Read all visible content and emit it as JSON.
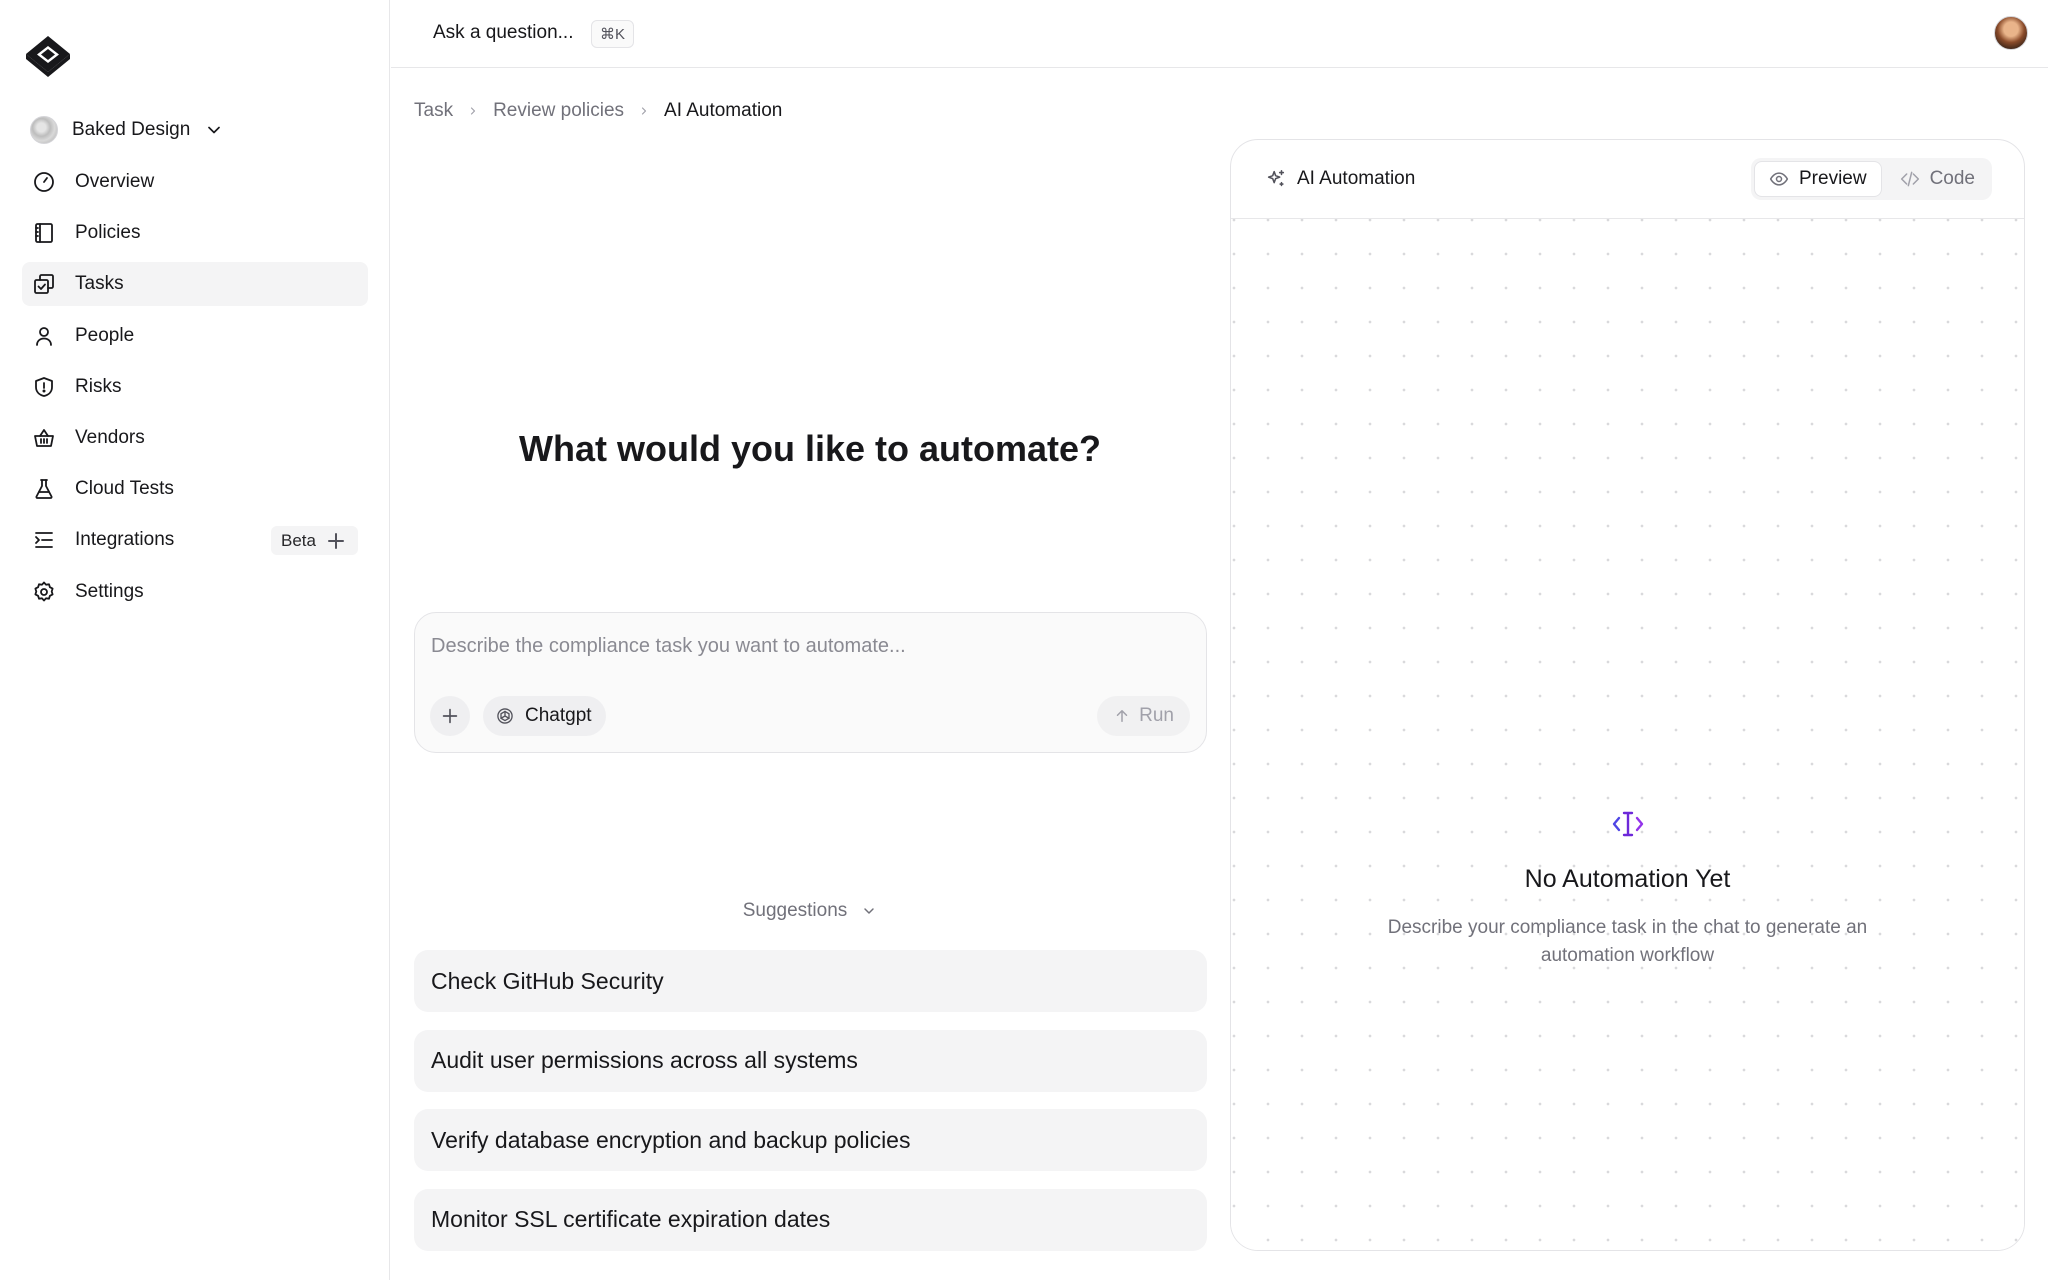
{
  "sidebar": {
    "org_name": "Baked Design",
    "items": [
      {
        "label": "Overview",
        "icon": "gauge-icon"
      },
      {
        "label": "Policies",
        "icon": "book-icon"
      },
      {
        "label": "Tasks",
        "icon": "tasks-icon",
        "active": true
      },
      {
        "label": "People",
        "icon": "user-icon"
      },
      {
        "label": "Risks",
        "icon": "shield-alert-icon"
      },
      {
        "label": "Vendors",
        "icon": "basket-icon"
      },
      {
        "label": "Cloud Tests",
        "icon": "flask-icon"
      },
      {
        "label": "Integrations",
        "icon": "list-indent-icon",
        "badge": "Beta"
      },
      {
        "label": "Settings",
        "icon": "gear-icon"
      }
    ]
  },
  "topbar": {
    "ask_label": "Ask a question...",
    "shortcut": "⌘K"
  },
  "breadcrumb": [
    "Task",
    "Review policies",
    "AI Automation"
  ],
  "main": {
    "headline": "What would you like to automate?",
    "composer": {
      "placeholder": "Describe the compliance task you want to automate...",
      "model": "Chatgpt",
      "run_label": "Run"
    },
    "suggestions_label": "Suggestions",
    "suggestions": [
      "Check GitHub Security",
      "Audit user permissions across all systems",
      "Verify database encryption and backup policies",
      "Monitor SSL certificate expiration dates"
    ]
  },
  "panel": {
    "title": "AI Automation",
    "tabs": {
      "preview": "Preview",
      "code": "Code"
    },
    "empty_title": "No Automation Yet",
    "empty_desc": "Describe your compliance task in the chat to generate an automation workflow"
  },
  "colors": {
    "text": "#18181b",
    "muted": "#71717a",
    "surface": "#f4f4f5",
    "border": "#e4e4e7",
    "icon_blue": "#4f46e5",
    "icon_purple": "#9333ea"
  }
}
